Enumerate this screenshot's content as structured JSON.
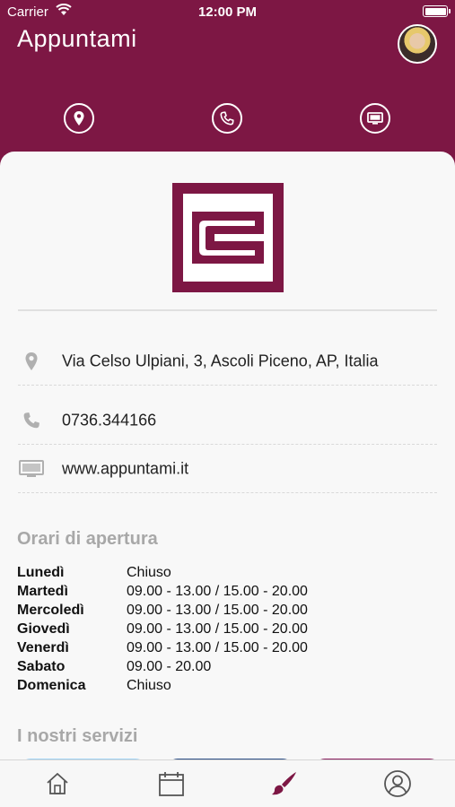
{
  "status_bar": {
    "carrier": "Carrier",
    "time": "12:00 PM"
  },
  "header": {
    "title": "Appuntami"
  },
  "actions": [
    {
      "icon": "location-pin-icon"
    },
    {
      "icon": "phone-icon"
    },
    {
      "icon": "monitor-icon"
    }
  ],
  "info": {
    "address": "Via Celso Ulpiani, 3, Ascoli Piceno, AP, Italia",
    "phone": "0736.344166",
    "website": "www.appuntami.it"
  },
  "hours": {
    "title": "Orari di apertura",
    "days": [
      {
        "day": "Lunedì",
        "value": "Chiuso"
      },
      {
        "day": "Martedì",
        "value": "09.00 - 13.00 / 15.00 - 20.00"
      },
      {
        "day": "Mercoledì",
        "value": "09.00 - 13.00 / 15.00 - 20.00"
      },
      {
        "day": "Giovedì",
        "value": "09.00 - 13.00 / 15.00 - 20.00"
      },
      {
        "day": "Venerdì",
        "value": "09.00 - 13.00 / 15.00 - 20.00"
      },
      {
        "day": "Sabato",
        "value": "09.00 - 20.00"
      },
      {
        "day": "Domenica",
        "value": "Chiuso"
      }
    ]
  },
  "services": {
    "title": "I nostri servizi"
  },
  "colors": {
    "brand": "#7d1744",
    "service_1": "#9fd3f5",
    "service_2": "#2c4f86",
    "service_3": "#8a1f5f"
  },
  "tabbar": [
    {
      "icon": "home-icon"
    },
    {
      "icon": "calendar-icon"
    },
    {
      "icon": "brush-icon",
      "active": true
    },
    {
      "icon": "profile-icon"
    }
  ]
}
